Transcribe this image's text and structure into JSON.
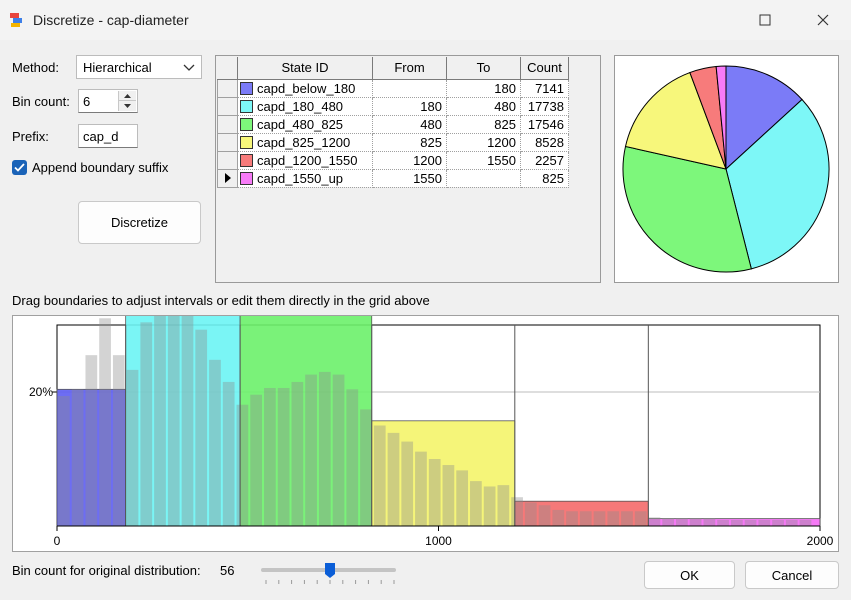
{
  "window": {
    "title": "Discretize - cap-diameter",
    "maximize_icon": "maximize-icon",
    "close_icon": "close-icon"
  },
  "form": {
    "method_label": "Method:",
    "method_value": "Hierarchical",
    "bin_count_label": "Bin count:",
    "bin_count_value": "6",
    "prefix_label": "Prefix:",
    "prefix_value": "cap_d",
    "append_suffix_label": "Append boundary suffix",
    "append_suffix_checked": true,
    "discretize_button": "Discretize"
  },
  "grid": {
    "columns": [
      "State ID",
      "From",
      "To",
      "Count"
    ],
    "rows": [
      {
        "state_id": "capd_below_180",
        "from": "",
        "to": "180",
        "count": "7141",
        "color": "#7b7bf7"
      },
      {
        "state_id": "capd_180_480",
        "from": "180",
        "to": "480",
        "count": "17738",
        "color": "#7df7f7"
      },
      {
        "state_id": "capd_480_825",
        "from": "480",
        "to": "825",
        "count": "17546",
        "color": "#7df77b"
      },
      {
        "state_id": "capd_825_1200",
        "from": "825",
        "to": "1200",
        "count": "8528",
        "color": "#f7f77b"
      },
      {
        "state_id": "capd_1200_1550",
        "from": "1200",
        "to": "1550",
        "count": "2257",
        "color": "#f77b7b"
      },
      {
        "state_id": "capd_1550_up",
        "from": "1550",
        "to": "",
        "count": "825",
        "color": "#f77bf7"
      }
    ],
    "current_row_index": 5
  },
  "hint_text": "Drag boundaries to adjust intervals or edit them directly in the grid above",
  "chart_data": [
    {
      "type": "pie",
      "categories": [
        "capd_below_180",
        "capd_180_480",
        "capd_480_825",
        "capd_825_1200",
        "capd_1200_1550",
        "capd_1550_up"
      ],
      "values": [
        7141,
        17738,
        17546,
        8528,
        2257,
        825
      ],
      "colors": [
        "#7b7bf7",
        "#7df7f7",
        "#7df77b",
        "#f7f77b",
        "#f77b7b",
        "#f77bf7"
      ]
    },
    {
      "type": "bar",
      "xlim": [
        0,
        2000
      ],
      "ylim": [
        0,
        0.3
      ],
      "x_ticks": [
        "0",
        "1000",
        "2000"
      ],
      "y_ticks": [
        "20%"
      ],
      "y_tick_values": [
        0.2
      ],
      "boundaries": [
        180,
        480,
        825,
        1200,
        1550
      ],
      "interval_heights": [
        0.204,
        0.333,
        0.333,
        0.157,
        0.037,
        0.011
      ],
      "interval_colors": [
        "#5d5df2",
        "#6cf4f4",
        "#6cf16a",
        "#f4f46a",
        "#f46a6a",
        "#f46af4"
      ],
      "bar_width": 36,
      "bars": [
        {
          "x": 18,
          "h": 0.194
        },
        {
          "x": 54,
          "h": 0.204
        },
        {
          "x": 90,
          "h": 0.255
        },
        {
          "x": 126,
          "h": 0.31
        },
        {
          "x": 162,
          "h": 0.255
        },
        {
          "x": 198,
          "h": 0.233
        },
        {
          "x": 234,
          "h": 0.304
        },
        {
          "x": 270,
          "h": 0.333
        },
        {
          "x": 306,
          "h": 0.333
        },
        {
          "x": 342,
          "h": 0.319
        },
        {
          "x": 378,
          "h": 0.293
        },
        {
          "x": 414,
          "h": 0.248
        },
        {
          "x": 450,
          "h": 0.215
        },
        {
          "x": 486,
          "h": 0.181
        },
        {
          "x": 522,
          "h": 0.196
        },
        {
          "x": 558,
          "h": 0.206
        },
        {
          "x": 594,
          "h": 0.206
        },
        {
          "x": 630,
          "h": 0.215
        },
        {
          "x": 666,
          "h": 0.226
        },
        {
          "x": 702,
          "h": 0.23
        },
        {
          "x": 738,
          "h": 0.226
        },
        {
          "x": 774,
          "h": 0.204
        },
        {
          "x": 810,
          "h": 0.174
        },
        {
          "x": 846,
          "h": 0.15
        },
        {
          "x": 882,
          "h": 0.139
        },
        {
          "x": 918,
          "h": 0.126
        },
        {
          "x": 954,
          "h": 0.111
        },
        {
          "x": 990,
          "h": 0.1
        },
        {
          "x": 1026,
          "h": 0.091
        },
        {
          "x": 1062,
          "h": 0.083
        },
        {
          "x": 1098,
          "h": 0.067
        },
        {
          "x": 1134,
          "h": 0.059
        },
        {
          "x": 1170,
          "h": 0.061
        },
        {
          "x": 1206,
          "h": 0.043
        },
        {
          "x": 1242,
          "h": 0.035
        },
        {
          "x": 1278,
          "h": 0.031
        },
        {
          "x": 1314,
          "h": 0.024
        },
        {
          "x": 1350,
          "h": 0.022
        },
        {
          "x": 1386,
          "h": 0.022
        },
        {
          "x": 1422,
          "h": 0.022
        },
        {
          "x": 1458,
          "h": 0.022
        },
        {
          "x": 1494,
          "h": 0.022
        },
        {
          "x": 1530,
          "h": 0.022
        },
        {
          "x": 1566,
          "h": 0.013
        },
        {
          "x": 1602,
          "h": 0.011
        },
        {
          "x": 1638,
          "h": 0.011
        },
        {
          "x": 1674,
          "h": 0.011
        },
        {
          "x": 1710,
          "h": 0.011
        },
        {
          "x": 1746,
          "h": 0.009
        },
        {
          "x": 1782,
          "h": 0.009
        },
        {
          "x": 1818,
          "h": 0.009
        },
        {
          "x": 1854,
          "h": 0.009
        },
        {
          "x": 1890,
          "h": 0.009
        },
        {
          "x": 1926,
          "h": 0.009
        },
        {
          "x": 1962,
          "h": 0.009
        }
      ]
    }
  ],
  "footer": {
    "bin_count_label": "Bin count for original distribution:",
    "bin_count_value": "56",
    "slider_value": 56,
    "slider_min": 0,
    "slider_max": 100,
    "ok_button": "OK",
    "cancel_button": "Cancel"
  }
}
